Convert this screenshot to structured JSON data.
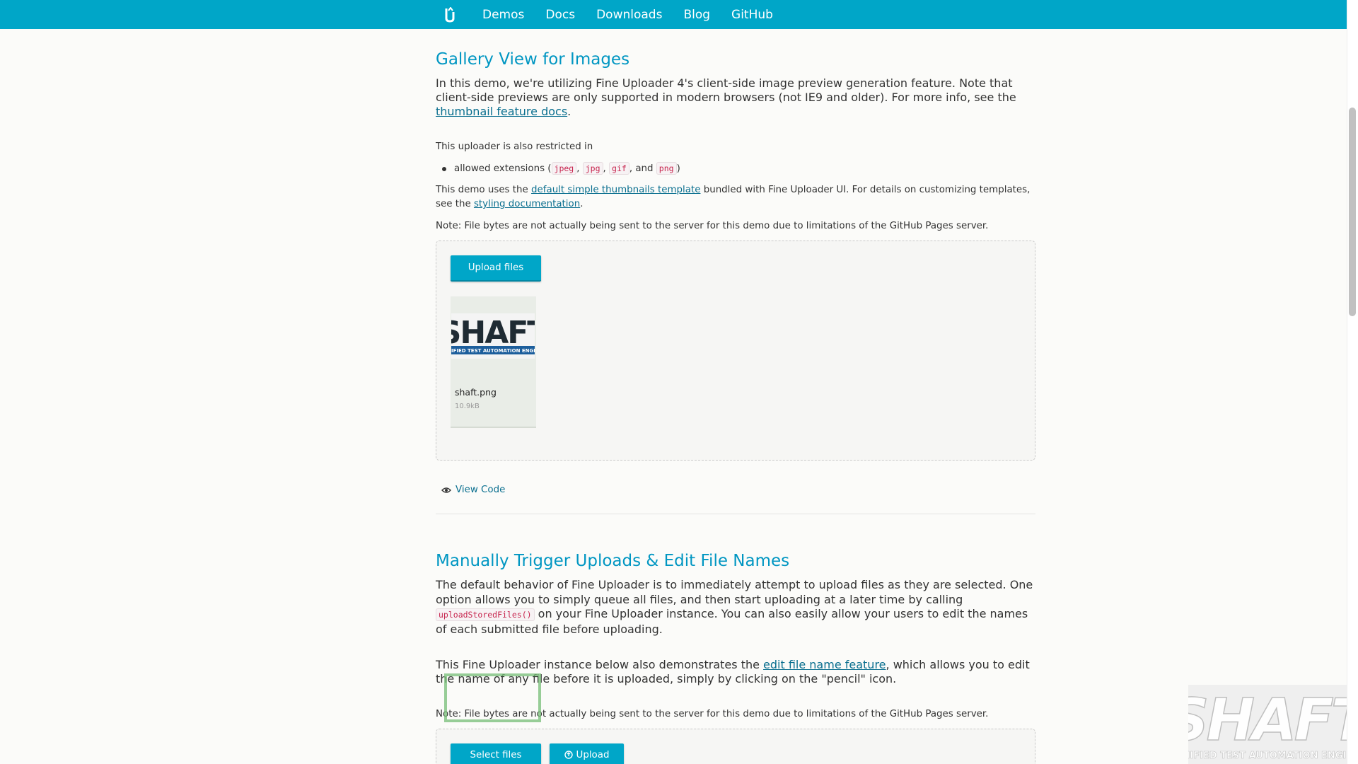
{
  "nav": {
    "logo_icon": "fine-uploader-logo-icon",
    "links": [
      "Demos",
      "Docs",
      "Downloads",
      "Blog",
      "GitHub"
    ]
  },
  "gallery": {
    "title": "Gallery View for Images",
    "intro_before": "In this demo, we're utilizing Fine Uploader 4's client-side image preview generation feature. Note that client-side previews are only supported in modern browsers (not IE9 and older). For more info, see the ",
    "intro_link": "thumbnail feature docs",
    "intro_after": ".",
    "restricted": "This uploader is also restricted in",
    "ext_prefix": "allowed extensions (",
    "ext": [
      "jpeg",
      "jpg",
      "gif",
      "png"
    ],
    "ext_sep": ", ",
    "ext_and": ", and ",
    "ext_suffix": ")",
    "template_before": "This demo uses the ",
    "template_link": "default simple thumbnails template",
    "template_middle": " bundled with Fine Uploader UI. For details on customizing templates, see the ",
    "template_link2": "styling documentation",
    "template_after": ".",
    "note": "Note: File bytes are not actually being sent to the server for this demo due to limitations of the GitHub Pages server.",
    "upload_button": "Upload files",
    "file": {
      "thumb_text": "SHAFT",
      "thumb_subtext": "UNIFIED TEST AUTOMATION ENGINE",
      "name": "shaft.png",
      "size": "10.9kB"
    },
    "view_code": "View Code"
  },
  "manual": {
    "title": "Manually Trigger Uploads & Edit File Names",
    "p1_before": "The default behavior of Fine Uploader is to immediately attempt to upload files as they are selected. One option allows you to simply queue all files, and then start uploading at a later time by calling ",
    "p1_code": "uploadStoredFiles()",
    "p1_after": " on your Fine Uploader instance. You can also easily allow your users to edit the names of each submitted file before uploading.",
    "p2_before": "This Fine Uploader instance below also demonstrates the ",
    "p2_link": "edit file name feature",
    "p2_after": ", which allows you to edit the name of any file before it is uploaded, simply by clicking on the \"pencil\" icon.",
    "note": "Note: File bytes are not actually being sent to the server for this demo due to limitations of the GitHub Pages server.",
    "select_button": "Select files",
    "upload_button": "Upload"
  },
  "watermark": {
    "text": "SHAFT",
    "subtext": "UNIFIED TEST AUTOMATION ENGINE"
  },
  "colors": {
    "brand": "#00a6c8",
    "heading": "#0096c2",
    "link": "#0a6f8f"
  }
}
